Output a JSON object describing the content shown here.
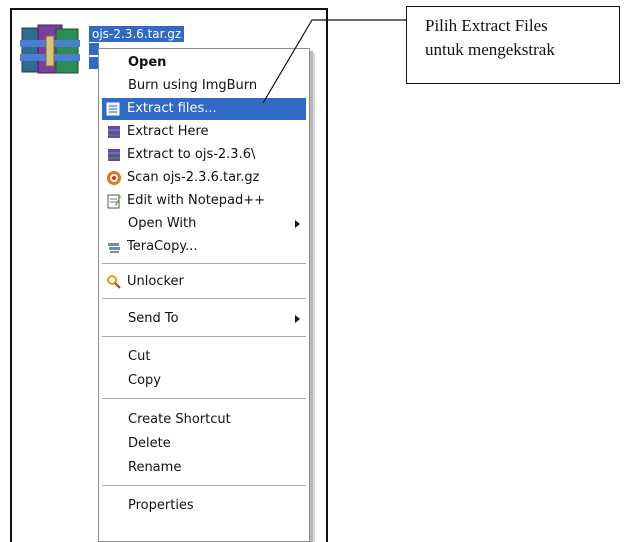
{
  "file": {
    "name": "ojs-2.3.6.tar.gz",
    "icon": "winrar-archive-icon"
  },
  "menu": {
    "items": [
      {
        "label": "Open",
        "icon": "none",
        "bold": true
      },
      {
        "label": "Burn using ImgBurn",
        "icon": "none"
      },
      {
        "label": "Extract files...",
        "icon": "extract-files-icon",
        "highlighted": true
      },
      {
        "label": "Extract Here",
        "icon": "winrar-icon"
      },
      {
        "label": "Extract to ojs-2.3.6\\",
        "icon": "winrar-icon"
      },
      {
        "label": "Scan ojs-2.3.6.tar.gz",
        "icon": "antivirus-icon"
      },
      {
        "label": "Edit with Notepad++",
        "icon": "notepad-icon"
      },
      {
        "label": "Open With",
        "icon": "none",
        "submenu": true
      },
      {
        "label": "TeraCopy...",
        "icon": "teracopy-icon"
      },
      {
        "label": "Unlocker",
        "icon": "unlocker-icon"
      },
      {
        "label": "Send To",
        "icon": "none",
        "submenu": true
      },
      {
        "label": "Cut",
        "icon": "none"
      },
      {
        "label": "Copy",
        "icon": "none"
      },
      {
        "label": "Create Shortcut",
        "icon": "none"
      },
      {
        "label": "Delete",
        "icon": "none"
      },
      {
        "label": "Rename",
        "icon": "none"
      },
      {
        "label": "Properties",
        "icon": "none"
      }
    ]
  },
  "callout": {
    "line1": "Pilih Extract Files",
    "line2": "untuk mengekstrak"
  },
  "colors": {
    "highlight": "#316ac5",
    "menu_border": "#8c8c8c"
  }
}
